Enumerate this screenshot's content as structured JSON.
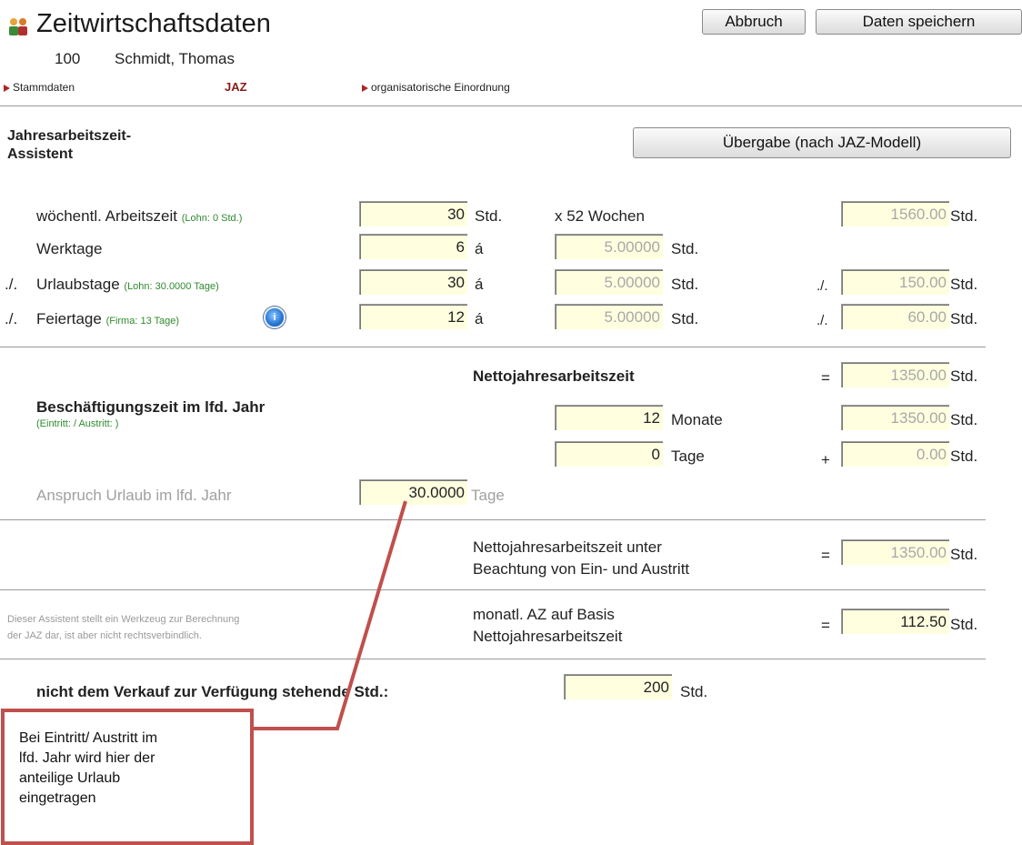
{
  "header": {
    "title": "Zeitwirtschaftsdaten",
    "employee_number": "100",
    "employee_name": "Schmidt, Thomas",
    "cancel_label": "Abbruch",
    "save_label": "Daten speichern"
  },
  "nav": {
    "stammdaten": "Stammdaten",
    "jaz": "JAZ",
    "org": "organisatorische Einordnung"
  },
  "assistant": {
    "heading_line1": "Jahresarbeitszeit-",
    "heading_line2": "Assistent",
    "transfer_label": "Übergabe (nach JAZ-Modell)"
  },
  "rows": {
    "weekly": {
      "label": "wöchentl. Arbeitszeit",
      "hint": "(Lohn: 0 Std.)",
      "value": "30",
      "unit": "Std.",
      "multiplier": "x 52 Wochen",
      "total": "1560.00",
      "total_unit": "Std."
    },
    "workdays": {
      "label": "Werktage",
      "value": "6",
      "sep": "á",
      "per_day": "5.00000",
      "per_day_unit": "Std."
    },
    "vacation": {
      "prefix": "./.",
      "label": "Urlaubstage",
      "hint": "(Lohn: 30.0000 Tage)",
      "value": "30",
      "sep": "á",
      "per_day": "5.00000",
      "per_day_unit": "Std.",
      "minus": "./.",
      "total": "150.00",
      "total_unit": "Std."
    },
    "holidays": {
      "prefix": "./.",
      "label": "Feiertage",
      "hint": "(Firma: 13 Tage)",
      "value": "12",
      "sep": "á",
      "per_day": "5.00000",
      "per_day_unit": "Std.",
      "minus": "./.",
      "total": "60.00",
      "total_unit": "Std."
    }
  },
  "net": {
    "label": "Nettojahresarbeitszeit",
    "eq": "=",
    "value": "1350.00",
    "unit": "Std."
  },
  "employment": {
    "heading": "Beschäftigungszeit im lfd. Jahr",
    "hint": "(Eintritt: / Austritt: )",
    "months": "12",
    "months_unit": "Monate",
    "months_total": "1350.00",
    "months_total_unit": "Std.",
    "days": "0",
    "days_unit": "Tage",
    "plus": "+",
    "days_total": "0.00",
    "days_total_unit": "Std."
  },
  "claim": {
    "label": "Anspruch Urlaub im lfd. Jahr",
    "value": "30.0000",
    "unit": "Tage"
  },
  "net_entry": {
    "line1": "Nettojahresarbeitszeit unter",
    "line2": "Beachtung von Ein- und Austritt",
    "eq": "=",
    "value": "1350.00",
    "unit": "Std."
  },
  "monthly": {
    "line1": "monatl. AZ auf Basis",
    "line2": "Nettojahresarbeitszeit",
    "eq": "=",
    "value": "112.50",
    "unit": "Std."
  },
  "disclaimer": {
    "line1": "Dieser Assistent stellt ein Werkzeug zur Berechnung",
    "line2": "der JAZ dar, ist aber nicht rechtsverbindlich."
  },
  "not_for_sale": {
    "label": "nicht dem Verkauf zur Verfügung stehende Std.:",
    "value": "200",
    "unit": "Std."
  },
  "callout": {
    "text": "Bei Eintritt/ Austritt im\nlfd. Jahr wird hier der\nanteilige Urlaub\neingetragen"
  },
  "colors": {
    "input_bg": "#ffffe0",
    "hint_green": "#2f8a2f",
    "nav_active": "#8b1a1a",
    "callout_border": "#c0504d"
  }
}
